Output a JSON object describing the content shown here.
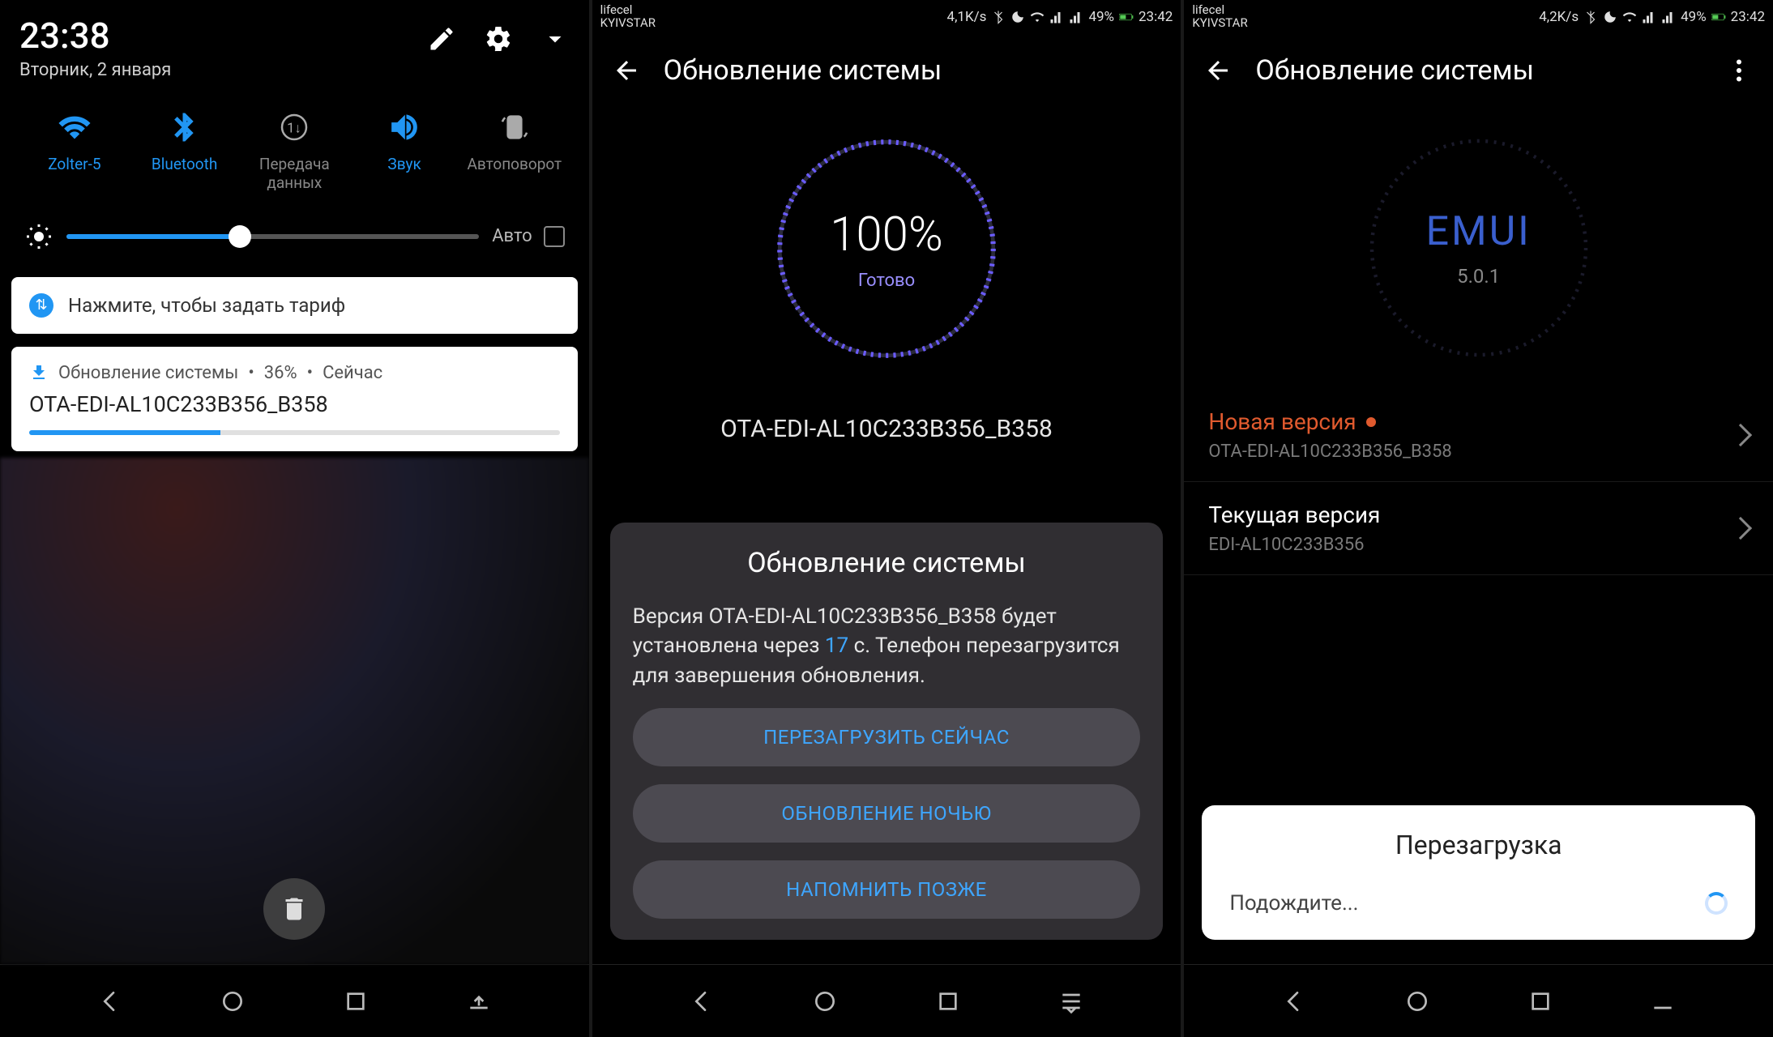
{
  "screen1": {
    "time": "23:38",
    "date": "Вторник, 2 января",
    "qs": {
      "wifi": "Zolter-5",
      "bt": "Bluetooth",
      "data": "Передача данных",
      "sound": "Звук",
      "rotate": "Автоповорот"
    },
    "brightness_auto": "Авто",
    "notif_tariff": "Нажмите, чтобы задать тариф",
    "notif_update": {
      "title": "Обновление системы",
      "percent": "36%",
      "when": "Сейчас",
      "version": "OTA-EDI-AL10C233B356_B358"
    }
  },
  "screen2": {
    "carrier_top": "lifecel",
    "carrier_bottom": "KYIVSTAR",
    "status_right": {
      "speed": "4,1K/s",
      "battery": "49%",
      "time": "23:42"
    },
    "title": "Обновление системы",
    "percent": "100%",
    "status": "Готово",
    "version_line": "OTA-EDI-AL10C233B356_B358",
    "dialog": {
      "title": "Обновление системы",
      "text_before": "Версия OTA-EDI-AL10C233B356_B358 будет установлена через ",
      "countdown": "17",
      "text_after": " с. Телефон перезагрузится для завершения обновления.",
      "btn1": "ПЕРЕЗАГРУЗИТЬ СЕЙЧАС",
      "btn2": "ОБНОВЛЕНИЕ НОЧЬЮ",
      "btn3": "НАПОМНИТЬ ПОЗЖЕ"
    }
  },
  "screen3": {
    "carrier_top": "lifecel",
    "carrier_bottom": "KYIVSTAR",
    "status_right": {
      "speed": "4,2K/s",
      "battery": "49%",
      "time": "23:42"
    },
    "title": "Обновление системы",
    "emui": "EMUI",
    "emui_ver": "5.0.1",
    "new_version": {
      "label": "Новая версия",
      "value": "OTA-EDI-AL10C233B356_B358"
    },
    "current_version": {
      "label": "Текущая версия",
      "value": "EDI-AL10C233B356"
    },
    "toast": {
      "title": "Перезагрузка",
      "body": "Подождите..."
    }
  }
}
